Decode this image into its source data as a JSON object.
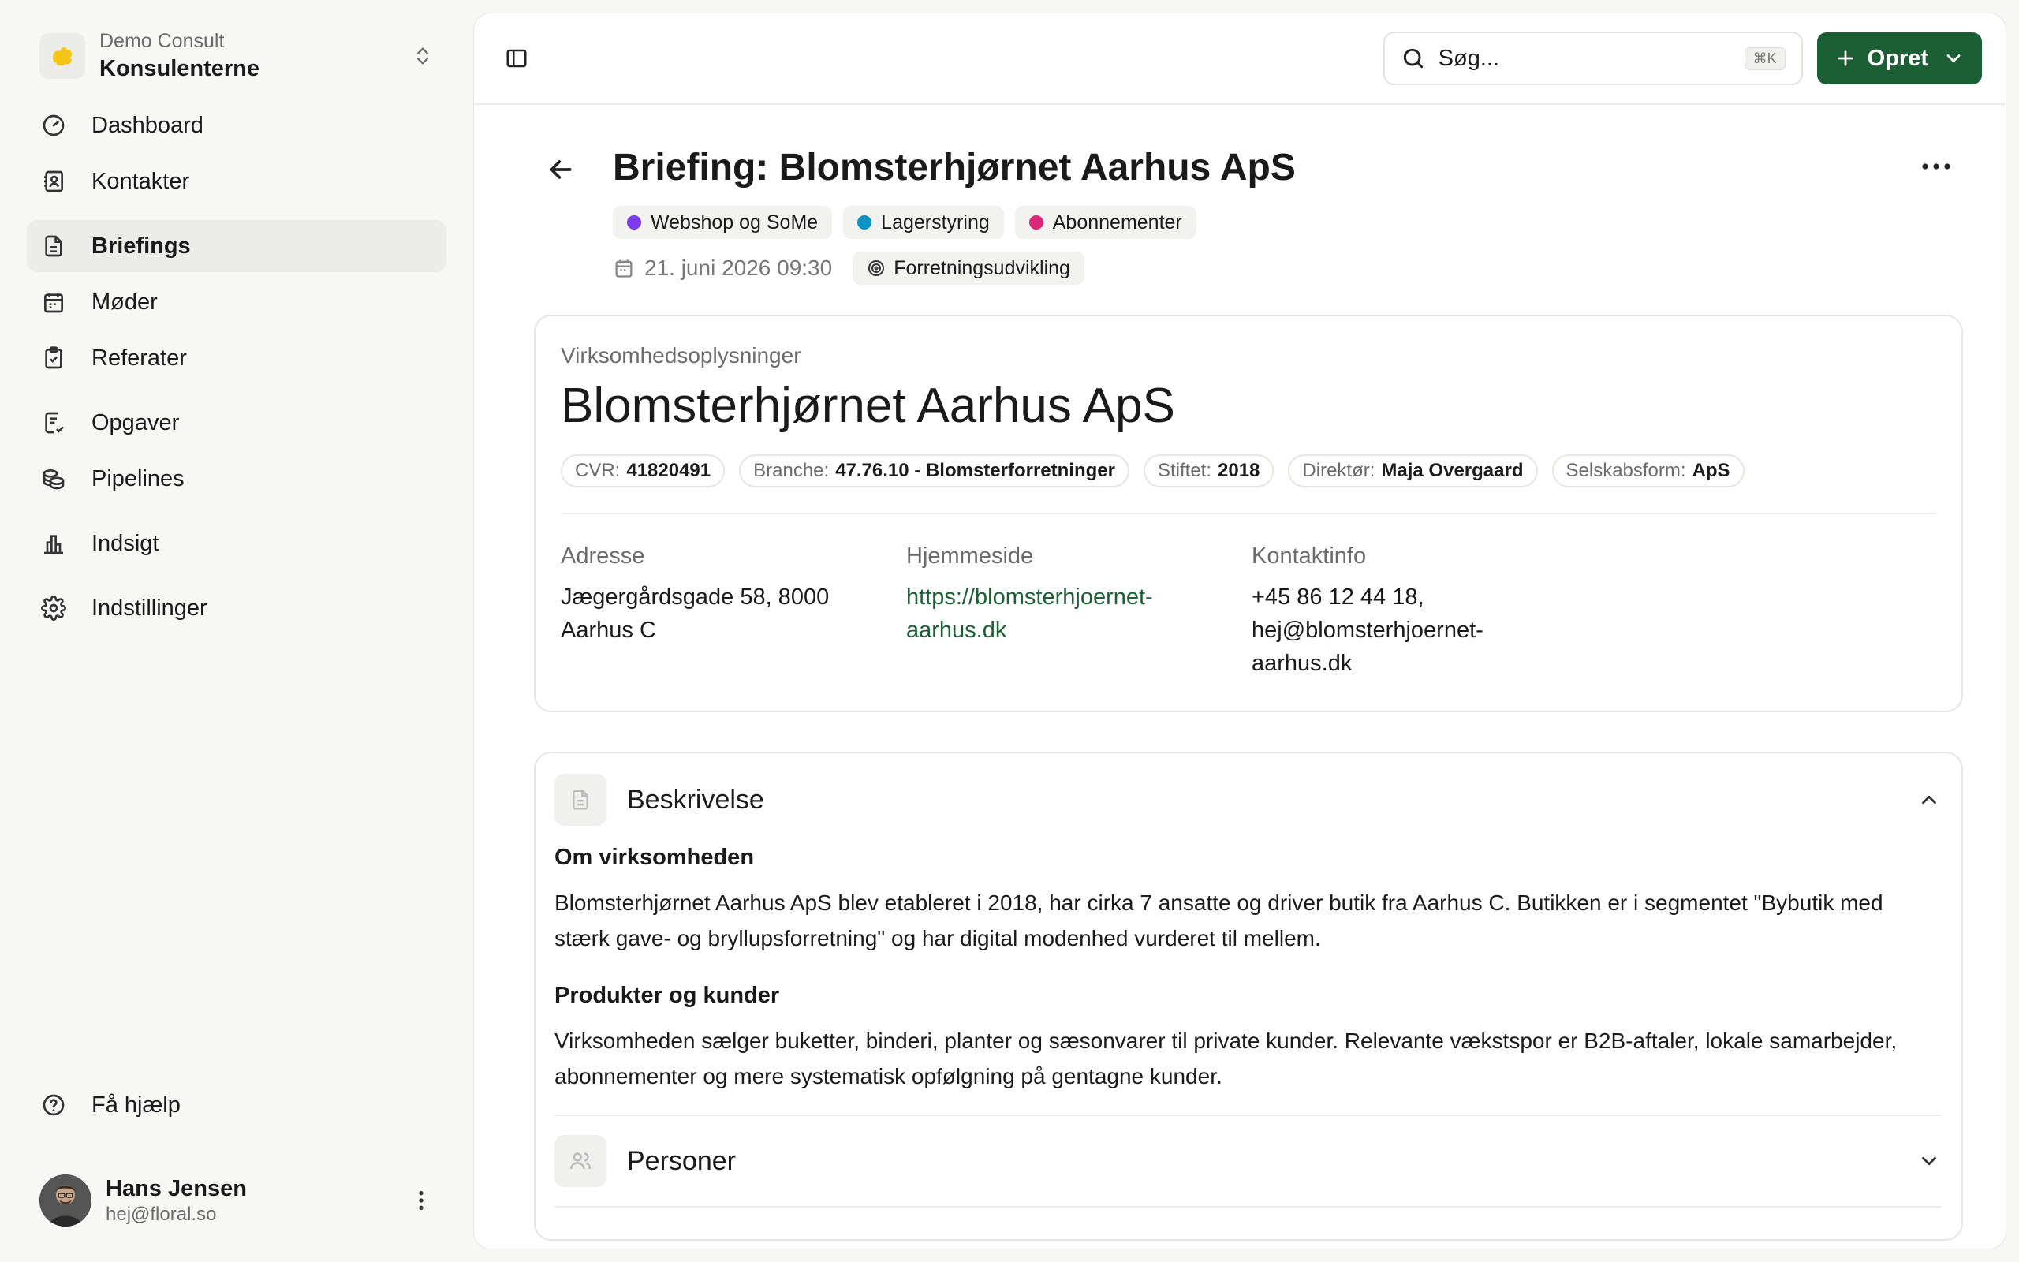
{
  "workspace": {
    "org": "Demo Consult",
    "name": "Konsulenterne"
  },
  "nav": {
    "dashboard": "Dashboard",
    "contacts": "Kontakter",
    "briefings": "Briefings",
    "meetings": "Møder",
    "minutes": "Referater",
    "tasks": "Opgaver",
    "pipelines": "Pipelines",
    "insights": "Indsigt",
    "settings": "Indstillinger",
    "help": "Få hjælp"
  },
  "user": {
    "name": "Hans Jensen",
    "email": "hej@floral.so"
  },
  "topbar": {
    "search_placeholder": "Søg...",
    "search_shortcut": "⌘K",
    "create_label": "Opret"
  },
  "briefing": {
    "title": "Briefing: Blomsterhjørnet Aarhus ApS",
    "tags": [
      {
        "label": "Webshop og SoMe",
        "color": "#7c3aed"
      },
      {
        "label": "Lagerstyring",
        "color": "#0e94c4"
      },
      {
        "label": "Abonnementer",
        "color": "#db2777"
      }
    ],
    "date": "21. juni 2026 09:30",
    "category": "Forretningsudvikling"
  },
  "company": {
    "section_label": "Virksomhedsoplysninger",
    "name": "Blomsterhjørnet Aarhus ApS",
    "facts": [
      {
        "key": "CVR:",
        "value": "41820491"
      },
      {
        "key": "Branche:",
        "value": "47.76.10 - Blomsterforretninger"
      },
      {
        "key": "Stiftet:",
        "value": "2018"
      },
      {
        "key": "Direktør:",
        "value": "Maja Overgaard"
      },
      {
        "key": "Selskabsform:",
        "value": "ApS"
      }
    ],
    "address_label": "Adresse",
    "address": "Jægergårdsgade 58, 8000 Aarhus C",
    "website_label": "Hjemmeside",
    "website": "https://blomsterhjoernet-aarhus.dk",
    "contact_label": "Kontaktinfo",
    "contact": "+45 86 12 44 18, hej@blomsterhjoernet-aarhus.dk"
  },
  "description": {
    "title": "Beskrivelse",
    "about_heading": "Om virksomheden",
    "about_text": "Blomsterhjørnet Aarhus ApS blev etableret i 2018, har cirka 7 ansatte og driver butik fra Aarhus C. Butikken er i segmentet \"Bybutik med stærk gave- og bryllupsforretning\" og har digital modenhed vurderet til mellem.",
    "products_heading": "Produkter og kunder",
    "products_text": "Virksomheden sælger buketter, binderi, planter og sæsonvarer til private kunder. Relevante vækstspor er B2B-aftaler, lokale samarbejder, abonnementer og mere systematisk opfølgning på gentagne kunder."
  },
  "persons": {
    "title": "Personer"
  }
}
